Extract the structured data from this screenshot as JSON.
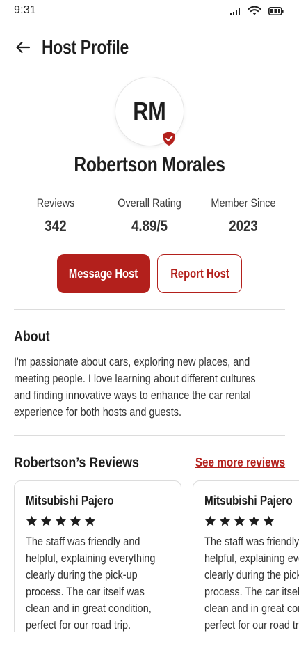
{
  "status_bar": {
    "time": "9:31",
    "icons": [
      "signal-icon",
      "wifi-icon",
      "battery-icon"
    ]
  },
  "header": {
    "back_icon": "arrow-left-icon",
    "title": "Host Profile"
  },
  "host": {
    "initials": "RM",
    "verified_icon": "shield-check-icon",
    "name": "Robertson Morales"
  },
  "stats": [
    {
      "label": "Reviews",
      "value": "342"
    },
    {
      "label": "Overall Rating",
      "value": "4.89/5"
    },
    {
      "label": "Member Since",
      "value": "2023"
    }
  ],
  "actions": {
    "message_label": "Message Host",
    "report_label": "Report Host"
  },
  "about": {
    "title": "About",
    "text": "I'm passionate about cars, exploring new places, and meeting people. I love learning about different cultures and finding innovative ways to enhance the car rental experience for both hosts and guests."
  },
  "reviews": {
    "title": "Robertson’s Reviews",
    "see_more_label": "See more reviews",
    "items": [
      {
        "car": "Mitsubishi Pajero",
        "rating": 5,
        "text": "The staff was friendly and helpful, explaining everything clearly during the pick-up process. The car itself was clean and in great condition, perfect for our road trip."
      },
      {
        "car": "Mitsubishi Pajero",
        "rating": 5,
        "text": "The staff was friendly and helpful, explaining everything clearly during the pick-up process. The car itself was clean and in great condition, perfect for our road trip."
      }
    ]
  },
  "colors": {
    "accent": "#b3201c",
    "text": "#1e1e1e",
    "divider": "#dcdcdc"
  }
}
